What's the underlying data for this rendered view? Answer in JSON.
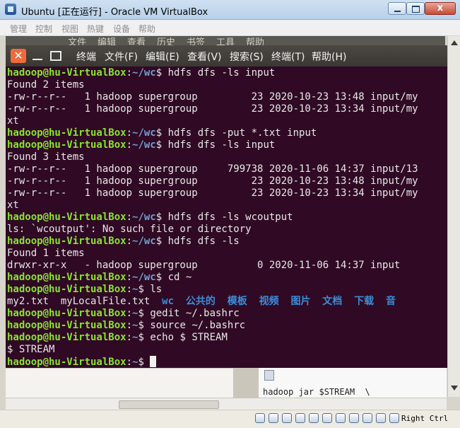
{
  "window": {
    "title": "Ubuntu [正在运行] - Oracle VM VirtualBox",
    "close_label": "x"
  },
  "vbox_menu": [
    "管理",
    "控制",
    "视图",
    "热键",
    "设备",
    "帮助"
  ],
  "bg_window_menu": [
    "文件",
    "编辑",
    "查看",
    "历史",
    "书签",
    "工具",
    "帮助"
  ],
  "terminal": {
    "close_label": "✕",
    "menu": [
      "终端",
      "文件(F)",
      "编辑(E)",
      "查看(V)",
      "搜索(S)",
      "终端(T)",
      "帮助(H)"
    ],
    "prompt": {
      "user": "hadoop@hu-VirtualBox",
      "sep": ":",
      "path_wc": "~/wc",
      "path_home": "~",
      "dollar": "$ "
    },
    "lines": {
      "l1_cmd": "hdfs dfs -ls input",
      "l2": "Found 2 items",
      "l3": "-rw-r--r--   1 hadoop supergroup         23 2020-10-23 13:48 input/my",
      "l4": "-rw-r--r--   1 hadoop supergroup         23 2020-10-23 13:34 input/my",
      "l5": "xt",
      "l6_cmd": "hdfs dfs -put *.txt input",
      "l7_cmd": "hdfs dfs -ls input",
      "l8": "Found 3 items",
      "l9": "-rw-r--r--   1 hadoop supergroup     799738 2020-11-06 14:37 input/13",
      "l10": "-rw-r--r--   1 hadoop supergroup         23 2020-10-23 13:48 input/my",
      "l11": "-rw-r--r--   1 hadoop supergroup         23 2020-10-23 13:34 input/my",
      "l12": "xt",
      "l13_cmd": "hdfs dfs -ls wcoutput",
      "l14": "ls: `wcoutput': No such file or directory",
      "l15_cmd": "hdfs dfs -ls",
      "l16": "Found 1 items",
      "l17": "drwxr-xr-x   - hadoop supergroup          0 2020-11-06 14:37 input",
      "l18_cmd": "cd ~",
      "l19_cmd": "ls",
      "l20_files": "my2.txt  myLocalFile.txt  ",
      "l20_dirs": "wc  公共的  模板  视频  图片  文档  下载  音",
      "l21_cmd": "gedit ~/.bashrc",
      "l22_cmd": "source ~/.bashrc",
      "l23_cmd": "echo $ STREAM",
      "l24": "$ STREAM"
    }
  },
  "background_doc": {
    "text": "hadoop jar $STREAM  \\"
  },
  "statusbar": {
    "host_key": "Right Ctrl"
  }
}
